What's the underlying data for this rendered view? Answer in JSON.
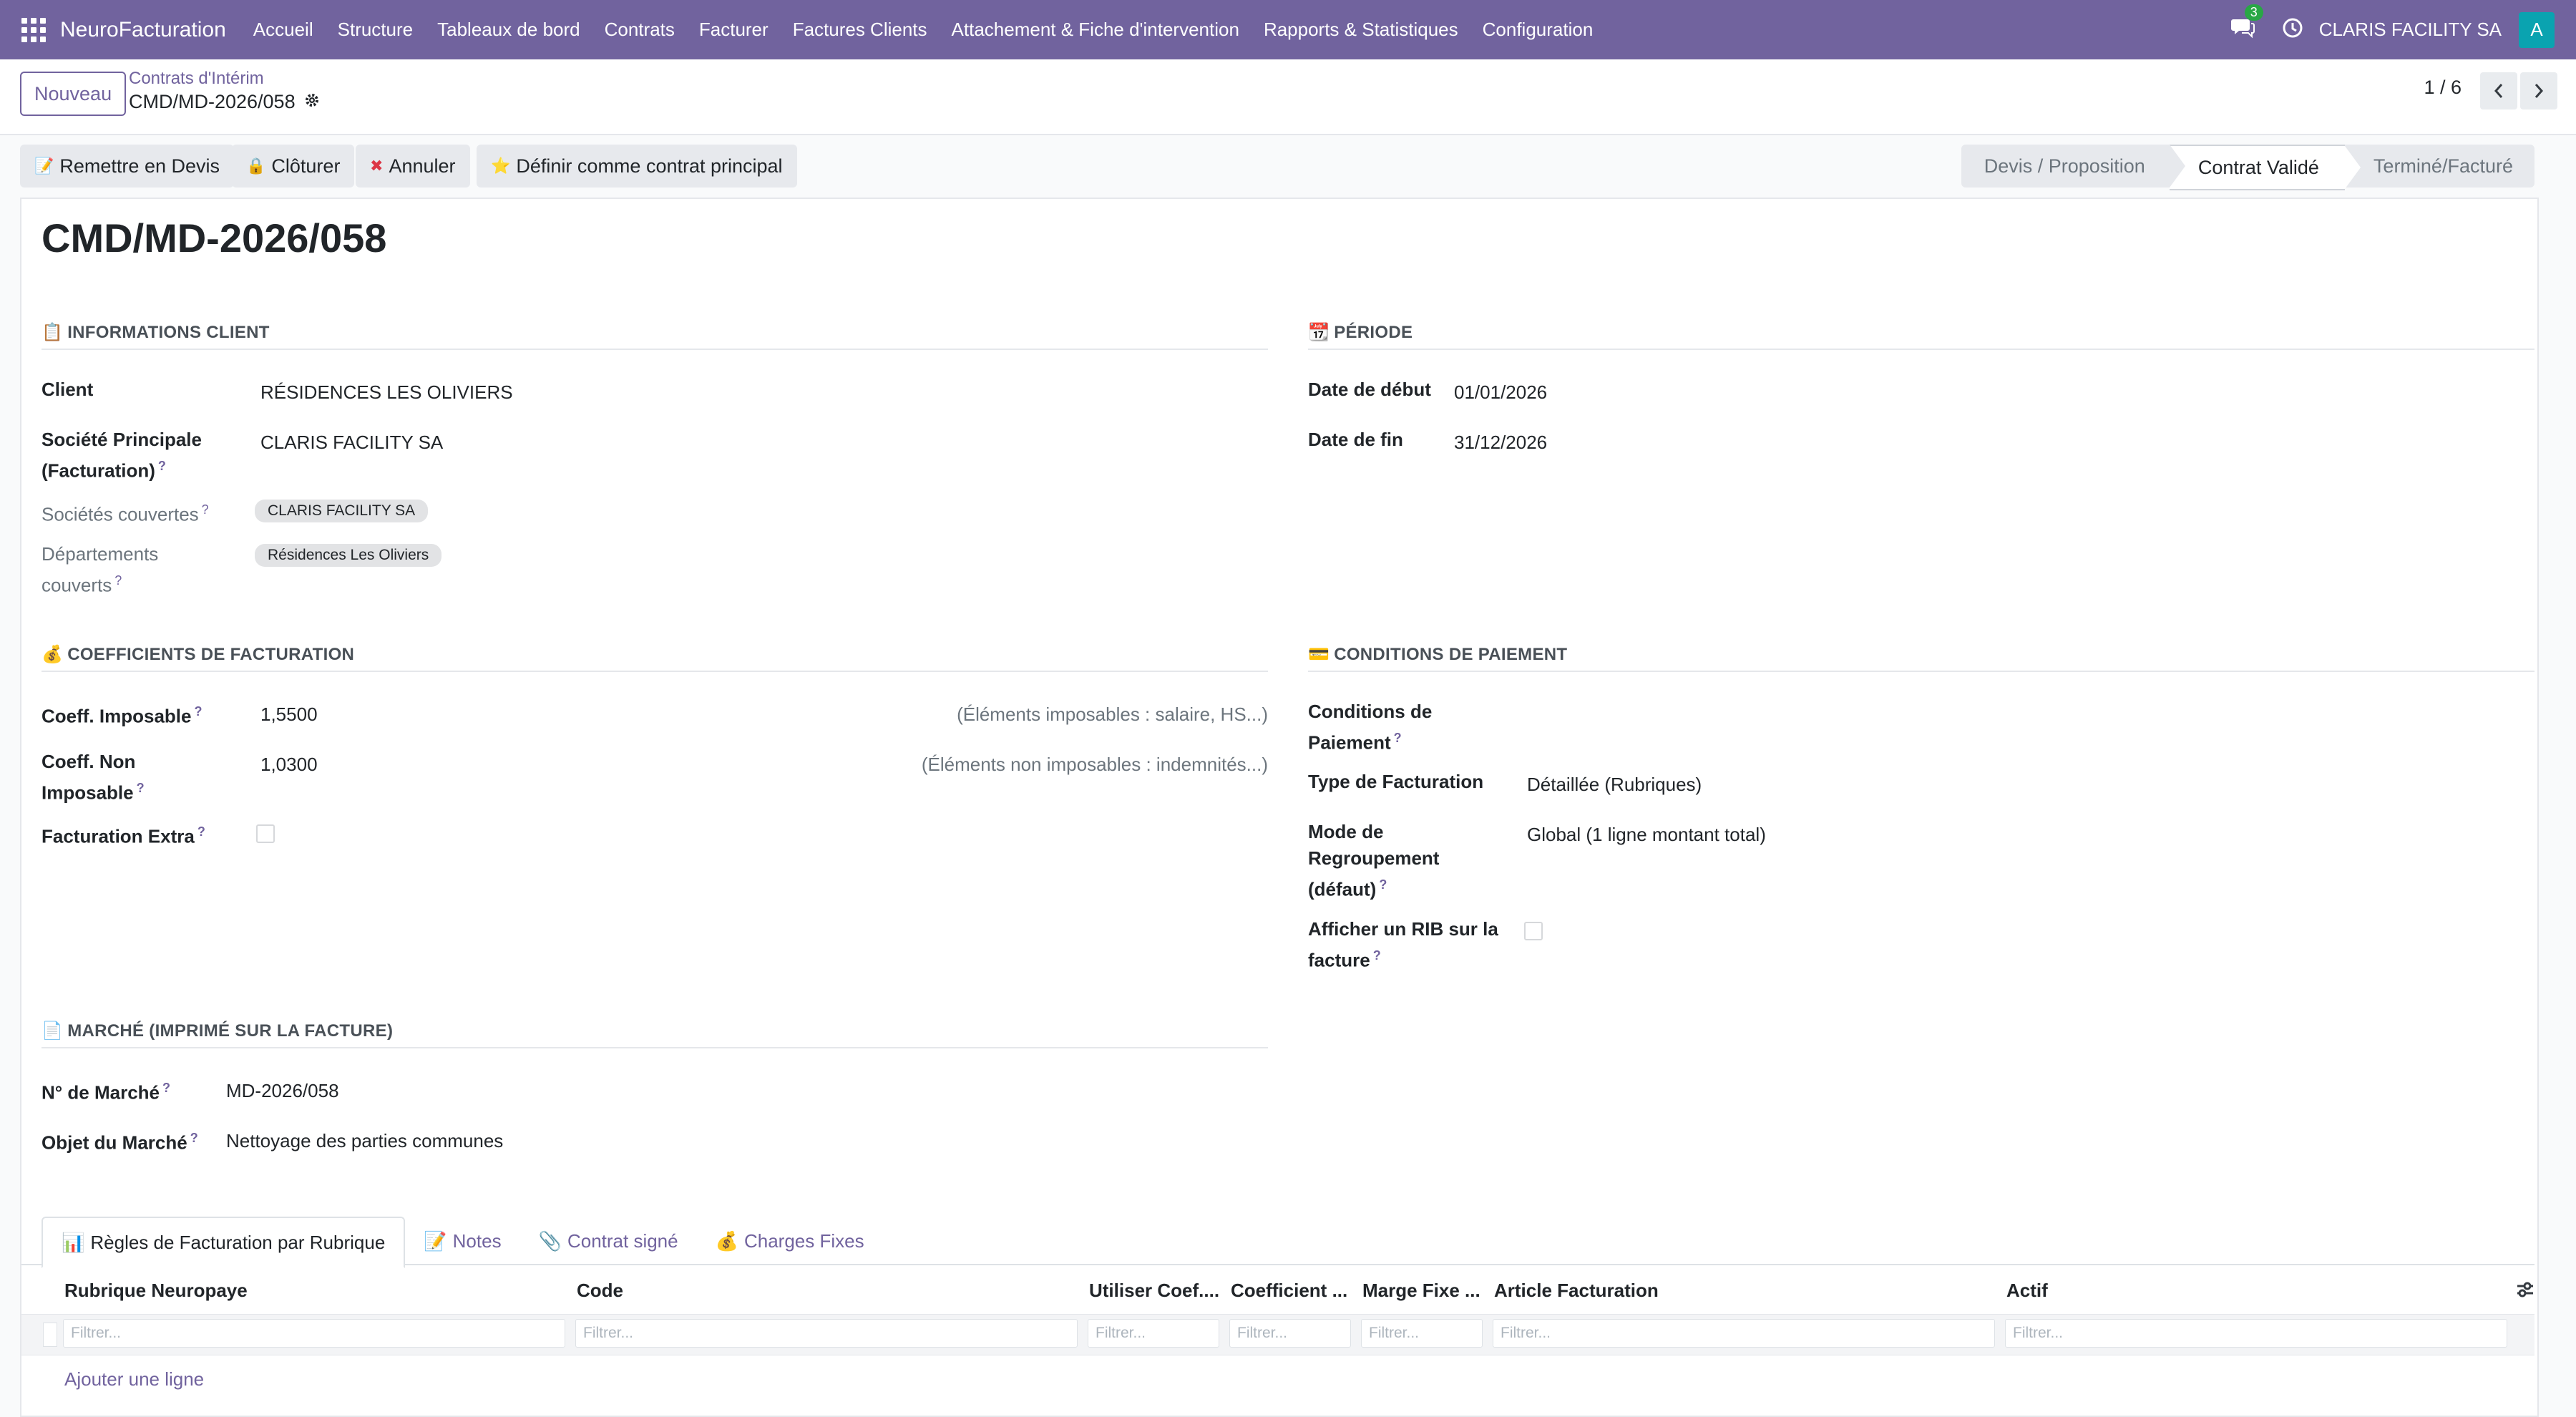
{
  "navbar": {
    "brand": "NeuroFacturation",
    "menu": [
      "Accueil",
      "Structure",
      "Tableaux de bord",
      "Contrats",
      "Facturer",
      "Factures Clients",
      "Attachement & Fiche d'intervention",
      "Rapports & Statistiques",
      "Configuration"
    ],
    "chat_count": "3",
    "company": "CLARIS FACILITY SA",
    "avatar_letter": "A",
    "bg_color": "#71639e"
  },
  "control": {
    "new_button": "Nouveau",
    "breadcrumb_parent": "Contrats d'Intérim",
    "breadcrumb_current": "CMD/MD-2026/058",
    "pager": "1 / 6"
  },
  "actions": {
    "reset_to_quote": "Remettre en Devis",
    "close": "Clôturer",
    "cancel": "Annuler",
    "set_main": "Définir comme contrat principal"
  },
  "status": {
    "stages": [
      "Devis / Proposition",
      "Contrat Validé",
      "Terminé/Facturé"
    ],
    "active_index": 1
  },
  "record": {
    "title": "CMD/MD-2026/058"
  },
  "client_info": {
    "heading": "INFORMATIONS CLIENT",
    "client_label": "Client",
    "client_value": "RÉSIDENCES LES OLIVIERS",
    "main_company_label_1": "Société Principale",
    "main_company_label_2": "(Facturation)",
    "main_company_value": "CLARIS FACILITY SA",
    "covered_companies_label": "Sociétés couvertes",
    "covered_companies_tag": "CLARIS FACILITY SA",
    "covered_departments_label_1": "Départements",
    "covered_departments_label_2": "couverts",
    "covered_departments_tag": "Résidences Les Oliviers"
  },
  "period": {
    "heading": "PÉRIODE",
    "start_label": "Date de début",
    "start_value": "01/01/2026",
    "end_label": "Date de fin",
    "end_value": "31/12/2026"
  },
  "coefficients": {
    "heading": "COEFFICIENTS DE FACTURATION",
    "taxable_label": "Coeff. Imposable",
    "taxable_value": "1,5500",
    "taxable_hint": "(Éléments imposables : salaire, HS...)",
    "nontaxable_label_1": "Coeff. Non",
    "nontaxable_label_2": "Imposable",
    "nontaxable_value": "1,0300",
    "nontaxable_hint": "(Éléments non imposables : indemnités...)",
    "extra_label": "Facturation Extra"
  },
  "payment": {
    "heading": "CONDITIONS DE PAIEMENT",
    "terms_label_1": "Conditions de",
    "terms_label_2": "Paiement",
    "billing_type_label": "Type de Facturation",
    "billing_type_value": "Détaillée (Rubriques)",
    "grouping_label_1": "Mode de",
    "grouping_label_2": "Regroupement",
    "grouping_label_3": "(défaut)",
    "grouping_value": "Global (1 ligne montant total)",
    "rib_label_1": "Afficher un RIB sur la",
    "rib_label_2": "facture"
  },
  "market": {
    "heading": "MARCHÉ (IMPRIMÉ SUR LA FACTURE)",
    "number_label": "N° de Marché",
    "number_value": "MD-2026/058",
    "object_label": "Objet du Marché",
    "object_value": "Nettoyage des parties communes"
  },
  "notebook": {
    "tabs": [
      "Règles de Facturation par Rubrique",
      "Notes",
      "Contrat signé",
      "Charges Fixes"
    ],
    "columns": [
      "Rubrique Neuropaye",
      "Code",
      "Utiliser Coef....",
      "Coefficient ...",
      "Marge Fixe ...",
      "Article Facturation",
      "Actif"
    ],
    "filter_placeholder": "Filtrer...",
    "add_line": "Ajouter une ligne"
  }
}
